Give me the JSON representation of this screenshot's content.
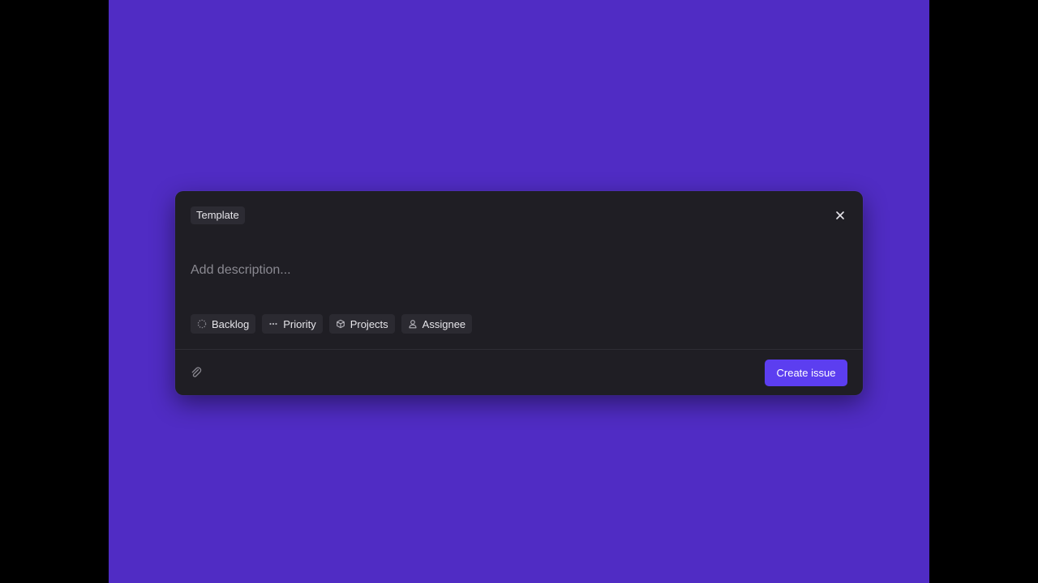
{
  "modal": {
    "template_label": "Template",
    "close_icon": "close-icon",
    "description": {
      "value": "",
      "placeholder": "Add description..."
    },
    "properties": [
      {
        "label": "Backlog",
        "icon": "backlog-status-icon"
      },
      {
        "label": "Priority",
        "icon": "priority-icon"
      },
      {
        "label": "Projects",
        "icon": "project-cube-icon"
      },
      {
        "label": "Assignee",
        "icon": "person-icon"
      }
    ],
    "attach_icon": "paperclip-icon",
    "create_label": "Create issue"
  },
  "colors": {
    "background": "#502cc4",
    "letterbox": "#000000",
    "modal": "#1f1e24",
    "chip": "#2b2a31",
    "accent": "#5c3ef0"
  }
}
